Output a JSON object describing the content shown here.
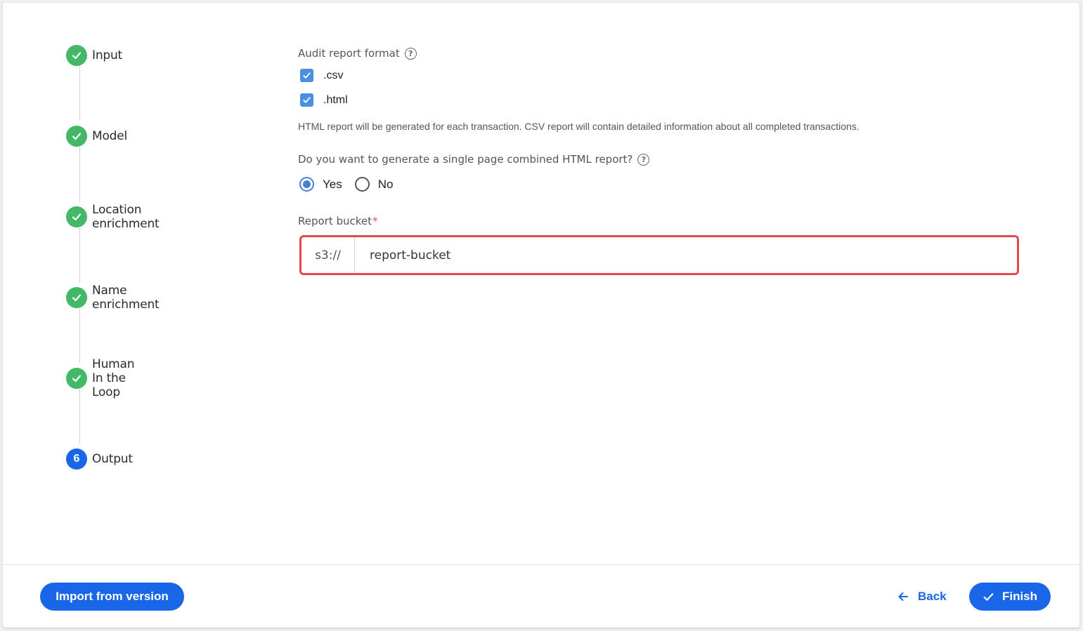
{
  "steps": [
    {
      "label": "Input",
      "status": "done"
    },
    {
      "label": "Model",
      "status": "done"
    },
    {
      "label": "Location enrichment",
      "status": "done"
    },
    {
      "label": "Name enrichment",
      "status": "done"
    },
    {
      "label": "Human In the Loop",
      "status": "done"
    },
    {
      "label": "Output",
      "status": "active",
      "number": "6"
    }
  ],
  "audit": {
    "label": "Audit report format",
    "help_glyph": "?",
    "options": [
      {
        "label": ".csv",
        "checked": true
      },
      {
        "label": ".html",
        "checked": true
      }
    ],
    "hint": "HTML report will be generated for each transaction. CSV report will contain detailed information about all completed transactions."
  },
  "combined": {
    "label": "Do you want to generate a single page combined HTML report?",
    "help_glyph": "?",
    "options": [
      {
        "label": "Yes",
        "checked": true
      },
      {
        "label": "No",
        "checked": false
      }
    ]
  },
  "bucket": {
    "label": "Report bucket",
    "required_mark": "*",
    "prefix": "s3://",
    "value": "report-bucket"
  },
  "footer": {
    "import_label": "Import from version",
    "back_label": "Back",
    "finish_label": "Finish"
  },
  "colors": {
    "accent": "#1a66e8",
    "success": "#43b867",
    "error_border": "#e5484d",
    "checkbox": "#4a90e2"
  }
}
